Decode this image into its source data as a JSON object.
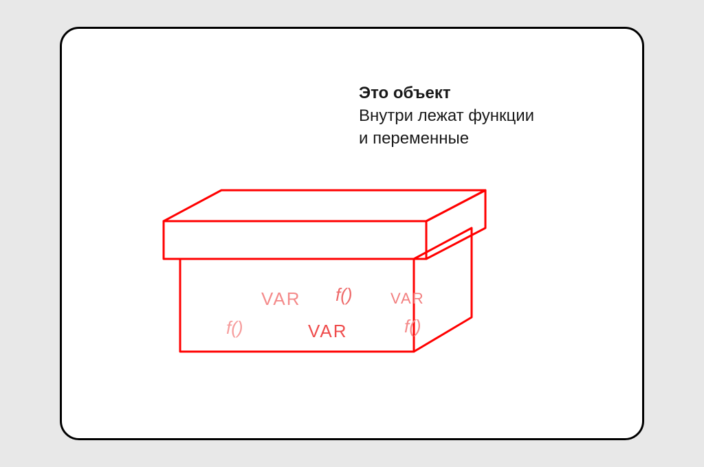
{
  "text": {
    "title": "Это объект",
    "subtitle_line1": "Внутри лежат функции",
    "subtitle_line2": "и переменные"
  },
  "box_lines_color": "#ff0000",
  "box_labels": {
    "var1": "VAR",
    "var2": "VAR",
    "var3": "VAR",
    "f1": "f()",
    "f2": "f()",
    "f3": "f()"
  }
}
